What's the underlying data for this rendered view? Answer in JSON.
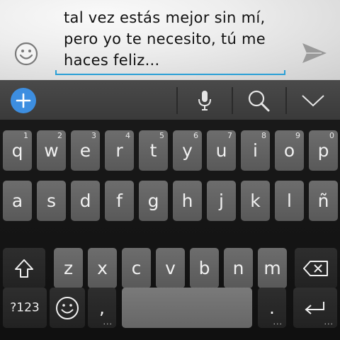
{
  "compose": {
    "message_text": "tal vez estás mejor sin mí,\npero yo te necesito, tú me\nhaces feliz...",
    "emoji_icon": "smiley-face-icon",
    "send_icon": "send-arrow-icon"
  },
  "toolbar": {
    "add_icon": "plus-circle-icon",
    "mic_icon": "microphone-icon",
    "search_icon": "magnifier-icon",
    "collapse_icon": "chevron-down-icon"
  },
  "keys": {
    "row1": [
      {
        "label": "q",
        "hint": "1"
      },
      {
        "label": "w",
        "hint": "2"
      },
      {
        "label": "e",
        "hint": "3"
      },
      {
        "label": "r",
        "hint": "4"
      },
      {
        "label": "t",
        "hint": "5"
      },
      {
        "label": "y",
        "hint": "6"
      },
      {
        "label": "u",
        "hint": "7"
      },
      {
        "label": "i",
        "hint": "8"
      },
      {
        "label": "o",
        "hint": "9"
      },
      {
        "label": "p",
        "hint": "0"
      }
    ],
    "row2": [
      "a",
      "s",
      "d",
      "f",
      "g",
      "h",
      "j",
      "k",
      "l",
      "ñ"
    ],
    "row3": [
      "z",
      "x",
      "c",
      "v",
      "b",
      "n",
      "m"
    ],
    "symbols_label": "?123",
    "comma_label": ",",
    "period_label": ".",
    "more_dots": "..."
  },
  "colors": {
    "accent": "#3d8ee0",
    "underline": "#2a9fd6",
    "key_bg": "#636363",
    "dark_key_bg": "#282828"
  }
}
